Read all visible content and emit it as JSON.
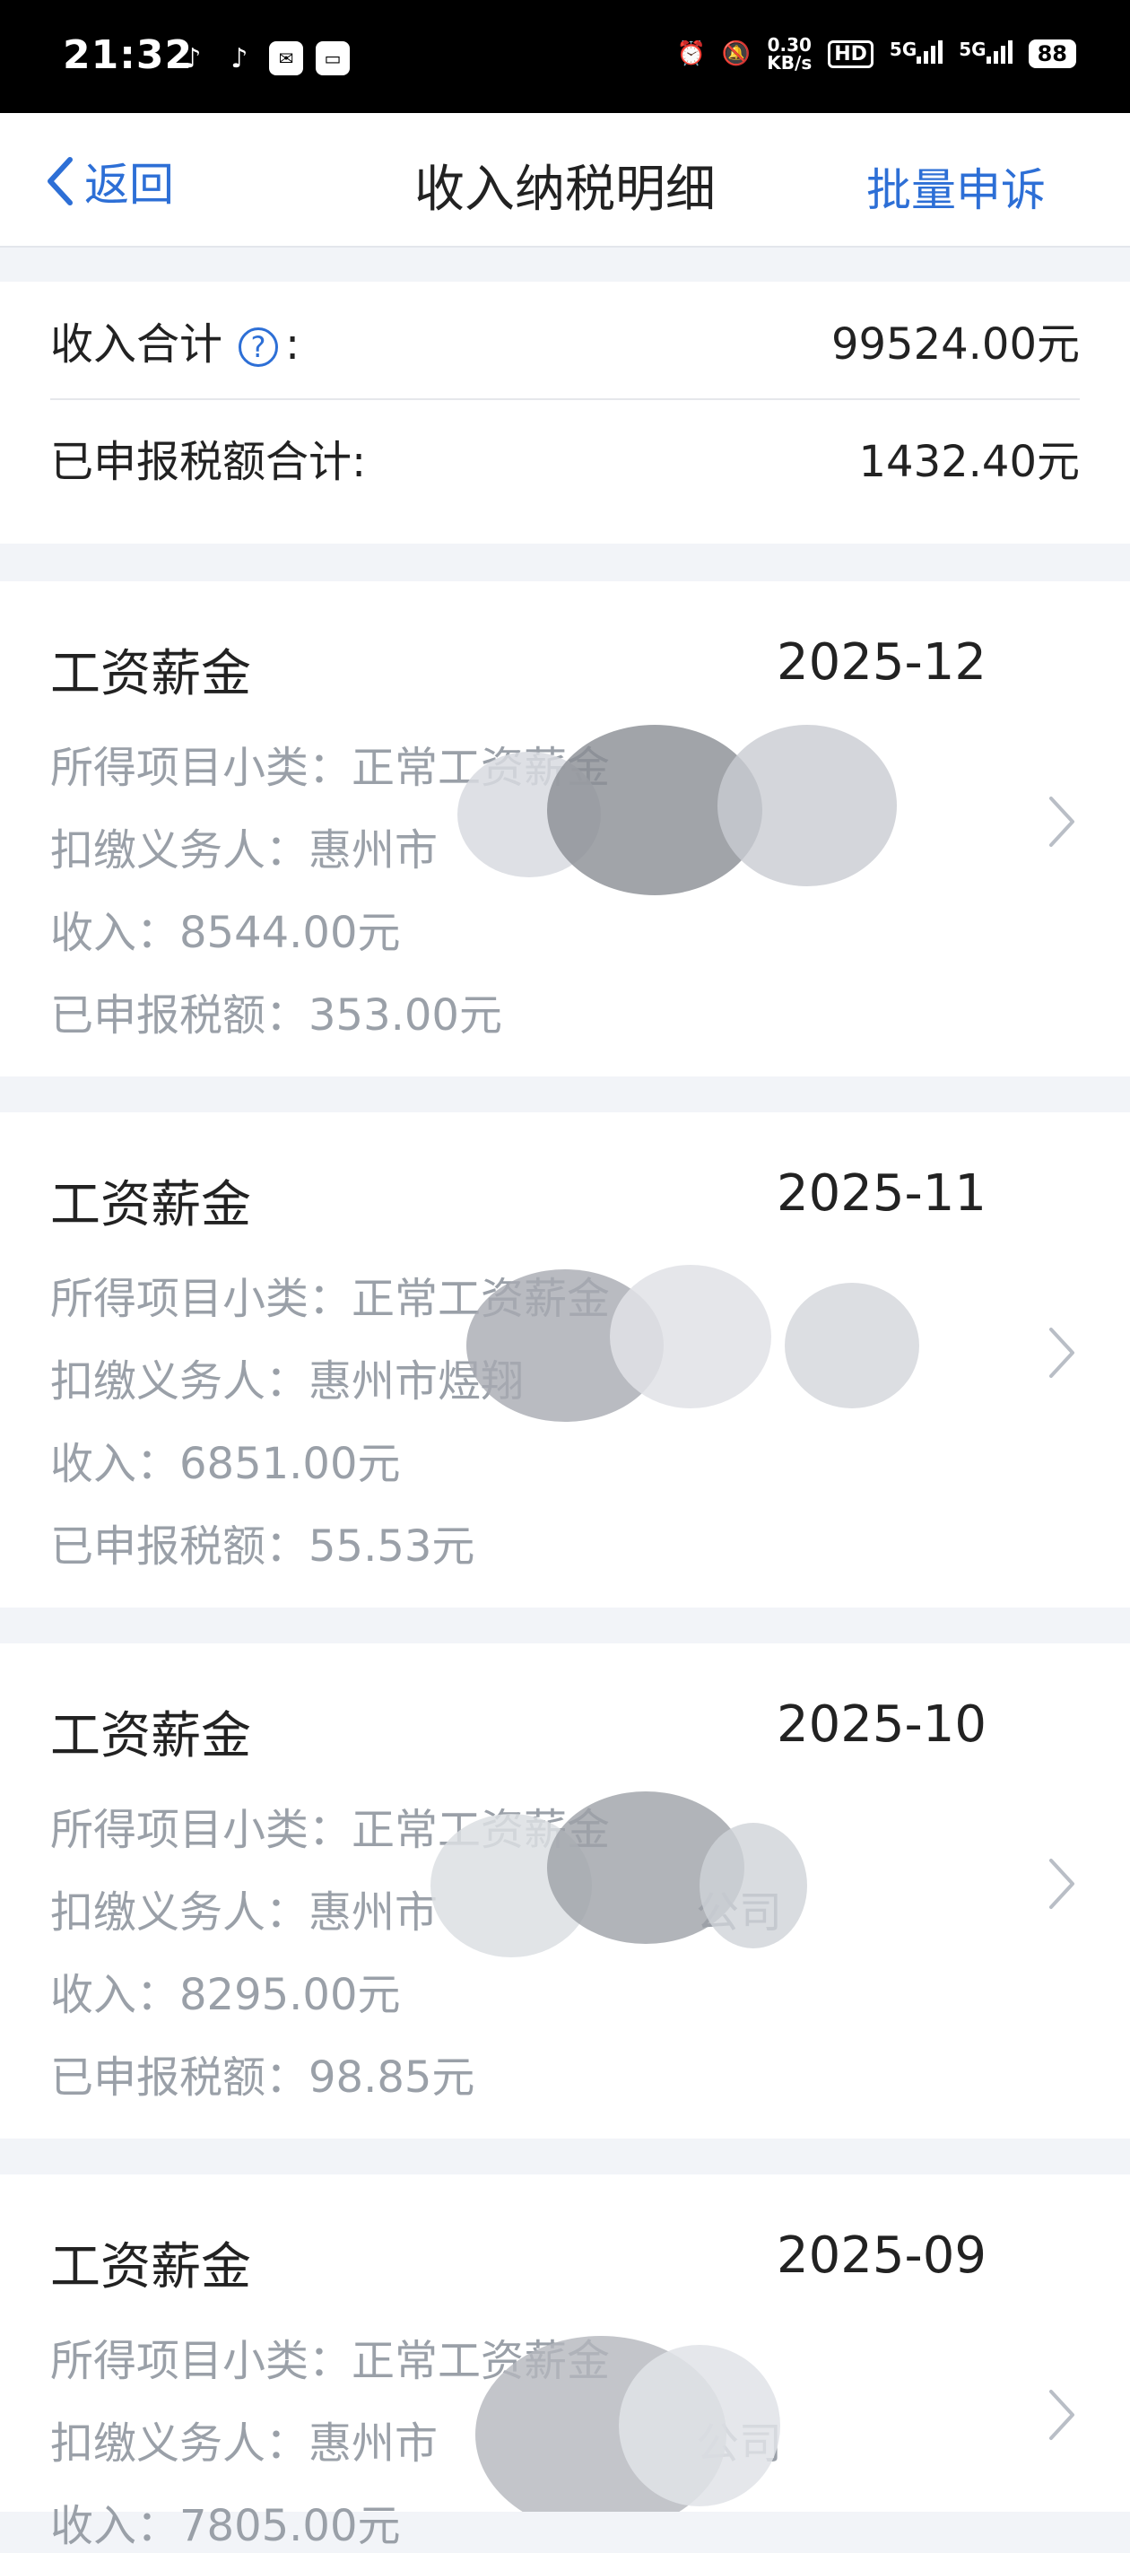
{
  "status_bar": {
    "time": "21:32",
    "net_speed_top": "0.30",
    "net_speed_bottom": "KB/s",
    "hd_badge": "HD",
    "signal_1": "5G",
    "signal_2": "5G",
    "battery": "88"
  },
  "nav": {
    "back_label": "返回",
    "title": "收入纳税明细",
    "action_label": "批量申诉"
  },
  "summary": {
    "income_label": "收入合计",
    "income_colon": ":",
    "income_value": "99524.00元",
    "tax_label": "已申报税额合计:",
    "tax_value": "1432.40元"
  },
  "records": [
    {
      "title": "工资薪金",
      "period": "2025-12",
      "subcategory": "所得项目小类：正常工资薪金",
      "withholder": "扣缴义务人：惠州市",
      "income": "收入：8544.00元",
      "tax": "已申报税额：353.00元"
    },
    {
      "title": "工资薪金",
      "period": "2025-11",
      "subcategory": "所得项目小类：正常工资薪金",
      "withholder": "扣缴义务人：惠州市煜翔",
      "income": "收入：6851.00元",
      "tax": "已申报税额：55.53元"
    },
    {
      "title": "工资薪金",
      "period": "2025-10",
      "subcategory": "所得项目小类：正常工资薪金",
      "withholder": "扣缴义务人：惠州市　　　　　　公司",
      "income": "收入：8295.00元",
      "tax": "已申报税额：98.85元"
    },
    {
      "title": "工资薪金",
      "period": "2025-09",
      "subcategory": "所得项目小类：正常工资薪金",
      "withholder": "扣缴义务人：惠州市　　　　　　公司",
      "income": "收入：7805.00元",
      "tax": ""
    }
  ],
  "colors": {
    "accent": "#2d6fd6",
    "secondary_text": "#9aa0a8",
    "background": "#f2f4f8"
  }
}
